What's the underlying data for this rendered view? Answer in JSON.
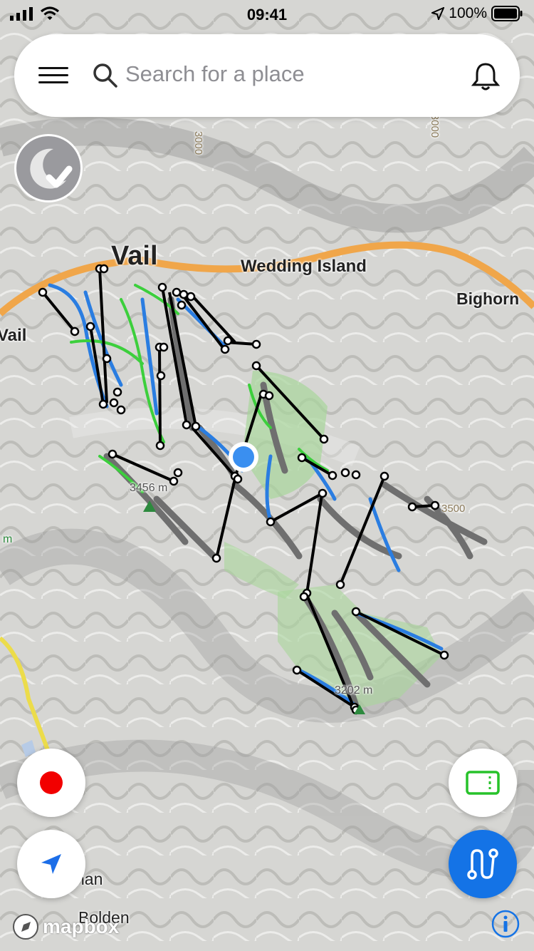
{
  "status_bar": {
    "time": "09:41",
    "battery": "100%",
    "icons": [
      "signal-bars-icon",
      "wifi-icon",
      "location-arrow-icon",
      "battery-icon"
    ]
  },
  "search": {
    "placeholder": "Search for a place",
    "icons": [
      "hamburger-menu-icon",
      "search-icon",
      "bell-icon"
    ]
  },
  "map": {
    "labels": {
      "vail": "Vail",
      "wedding_island": "Wedding Island",
      "bighorn": "Bighorn",
      "vail_west": "Vail",
      "peak_1": "3456 m",
      "peak_2": "3202 m",
      "contour_1": "3000",
      "contour_2": "3000",
      "contour_3": "3500",
      "edge_m": "m",
      "town_1": "nan",
      "town_2": "Bolden"
    },
    "colors": {
      "highway": "#f0a64a",
      "lift": "#000000",
      "green_run": "#3ccf3c",
      "blue_run": "#2a7de1",
      "black_run": "#6f6f6f",
      "location_dot": "#3a8ff0"
    }
  },
  "buttons": {
    "night_mode_icon": "moon-check-icon",
    "record_icon": "record-icon",
    "locate_icon": "navigation-arrow-icon",
    "ticket_icon": "lift-ticket-icon",
    "route_icon": "route-icon",
    "info_icon": "info-icon"
  },
  "attribution": {
    "text": "mapbox"
  }
}
